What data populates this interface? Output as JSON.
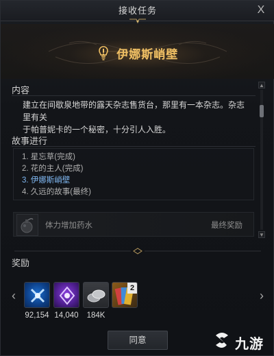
{
  "window": {
    "title": "接收任务",
    "close_glyph": "X"
  },
  "quest": {
    "name": "伊娜斯峭壁",
    "icon": "quest-exclamation-icon"
  },
  "content_section": {
    "label": "内容",
    "line1": "建立在间歇泉地带的露天杂志售货台，那里有一本杂志。杂志里有关",
    "line2": "于帕普妮卡的一个秘密，十分引人入胜。"
  },
  "story_section": {
    "label": "故事进行",
    "items": [
      {
        "text": "1. 星忘草(完成)"
      },
      {
        "text": "2. 花的主人(完成)"
      },
      {
        "text": "3. 伊娜斯峭壁"
      },
      {
        "text": "4. 久远的故事(最终)"
      }
    ],
    "current_index": 2,
    "final_reward": {
      "item_name": "体力增加药水",
      "label": "最终奖励",
      "icon": "potion-bomb-icon"
    }
  },
  "rewards_section": {
    "label": "奖励",
    "items": [
      {
        "icon": "blue-crossed-swords-icon",
        "count": "92,154",
        "color": "#2a7fd8"
      },
      {
        "icon": "purple-emblem-icon",
        "count": "14,040",
        "color": "#7a3fd0"
      },
      {
        "icon": "silver-coins-icon",
        "count": "184K",
        "color": "#8a8a8a"
      },
      {
        "icon": "card-pack-icon",
        "count": "",
        "badge": "2",
        "color": "#c0902a"
      }
    ]
  },
  "buttons": {
    "accept": "同意"
  },
  "watermark": {
    "text": "九游"
  },
  "colors": {
    "quest_title": "#f0c064",
    "current_step": "#7fb6ef"
  }
}
